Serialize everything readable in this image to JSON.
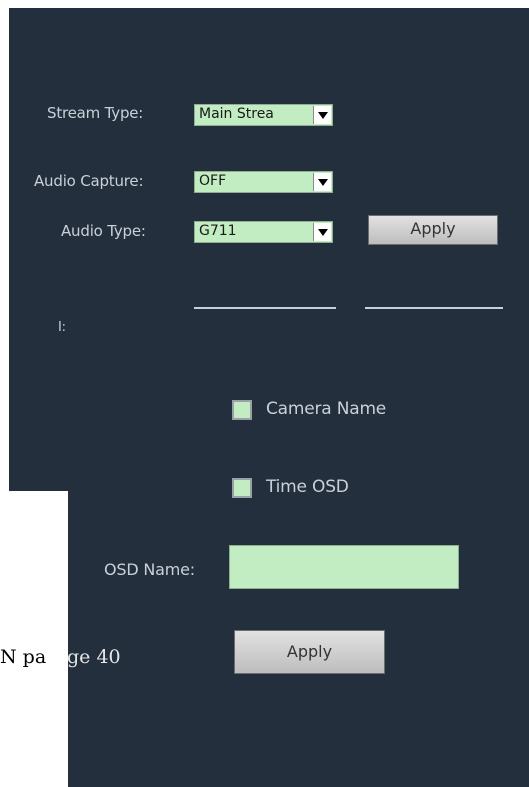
{
  "stream_type": {
    "label": "Stream Type:",
    "value": "Main Strea"
  },
  "audio_capture": {
    "label": "Audio Capture:",
    "value": "OFF"
  },
  "audio_type": {
    "label": "Audio Type:",
    "value": "G711"
  },
  "apply_top": "Apply",
  "partial_label": "I:",
  "camera_name": {
    "label": "Camera Name"
  },
  "time_osd": {
    "label": "Time OSD"
  },
  "osd_name": {
    "label": "OSD Name:",
    "value": ""
  },
  "apply_bottom": "Apply",
  "page_footer": {
    "prefix": "N pa",
    "suffix": "ge  40"
  }
}
